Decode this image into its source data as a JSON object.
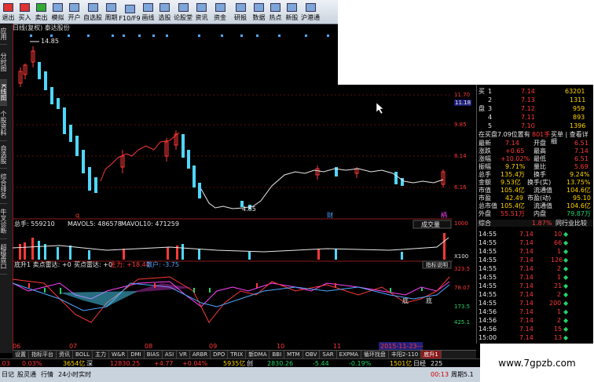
{
  "toolbar": {
    "items": [
      "退出",
      "买入",
      "卖出",
      "模拟",
      "开户",
      "自选股",
      "周期",
      "F10/F9",
      "画线",
      "选股",
      "论股堂",
      "资讯",
      "资金",
      "BBD",
      "研报",
      "预测",
      "数据",
      "热点",
      "新股",
      "沪港通"
    ]
  },
  "window": {
    "title": "日线(复权)  泰达股份"
  },
  "sidetabs": [
    "应用",
    "分时图",
    "K线图",
    "个股资料",
    "自选股",
    "综合排名",
    "牛叉诊断",
    "超级盘口"
  ],
  "price_axis": [
    "11.70",
    "11.18",
    "9.85",
    "8.14",
    "6.16"
  ],
  "price_axis_current": "11.18",
  "chart": {
    "high_label": "14.85",
    "low_label": "4.85",
    "markers": [
      "q",
      "财",
      "柄"
    ],
    "volume_header": "总手: 559210",
    "mavol5": "MAVOL5: 486578",
    "mavol10": "MAVOL10: 471259",
    "volume_dropdown": "成交量",
    "volume_axis": [
      "1000",
      "X100"
    ],
    "indicator_header": "底升1  卖点雷达: +0",
    "buy_radar": "买点雷达: +0",
    "main_force": "主力: +18.44",
    "retail": "散户: -3.75",
    "indicator_help": "指标说明",
    "indicator_axis": [
      "323.5",
      "78.07",
      "173.5",
      "425.1"
    ],
    "dates": [
      "06",
      "07",
      "08",
      "09",
      "10",
      "11"
    ],
    "date_highlight": "2015-11-23---",
    "tags": [
      "底",
      "底"
    ]
  },
  "bottom_tabs": [
    "设置",
    "指标平台",
    "资讯",
    "BOLL",
    "主力",
    "W&R",
    "DMI",
    "BIAS",
    "ASI",
    "VR",
    "ARBR",
    "DPO",
    "TRIX",
    "新DMA",
    "BBI",
    "MTM",
    "OBV",
    "SAR",
    "EXPMA",
    "循环找盘",
    "丰阳2-110",
    "底升1"
  ],
  "quote": {
    "sell_rows": [
      {
        "label": "1",
        "price": "7.14",
        "vol": "63201"
      },
      {
        "label": "2",
        "price": "7.13",
        "vol": "1311"
      },
      {
        "label": "3",
        "price": "7.12",
        "vol": "959"
      },
      {
        "label": "4",
        "price": "7.11",
        "vol": "893"
      },
      {
        "label": "5",
        "price": "7.10",
        "vol": "1396"
      }
    ],
    "side_label_buy": "买",
    "side_label_pan": "盘",
    "queue_line": "在买盘7.09位置有",
    "queue_count": "801手",
    "queue_link": "买单 | 查看详细",
    "stats": [
      {
        "k": "最新",
        "v": "7.14",
        "k2": "开盘",
        "v2": "6.51"
      },
      {
        "k": "涨跌",
        "v": "+0.65",
        "k2": "最高",
        "v2": "7.14"
      },
      {
        "k": "涨幅",
        "v": "+10.02%",
        "k2": "最低",
        "v2": "6.51"
      },
      {
        "k": "振幅",
        "v": "9.71%",
        "k2": "量比",
        "v2": "5.69"
      },
      {
        "k": "总手",
        "v": "135.4万",
        "k2": "换手",
        "v2": "9.24%"
      },
      {
        "k": "金额",
        "v": "9.53亿",
        "k2": "换手(实)",
        "v2": "13.75%"
      },
      {
        "k": "市值",
        "v": "105.4亿",
        "k2": "流通值",
        "v2": "104.6亿"
      },
      {
        "k": "市盈",
        "v": "42.49",
        "k2": "市盈(动)",
        "v2": "95.10"
      },
      {
        "k": "总市值",
        "v": "105.4亿",
        "k2": "流通值",
        "v2": "104.6亿"
      },
      {
        "k": "外盘",
        "v": "55.51万",
        "k2": "内盘",
        "v2": "79.87万"
      }
    ],
    "composite_label": "综合",
    "composite_value": "1.87%",
    "composite_link": "同行业比较",
    "trades": [
      {
        "t": "14:55",
        "p": "7.14",
        "v": "10"
      },
      {
        "t": "14:55",
        "p": "7.14",
        "v": "66"
      },
      {
        "t": "14:55",
        "p": "7.14",
        "v": "1"
      },
      {
        "t": "14:55",
        "p": "7.14",
        "v": "126"
      },
      {
        "t": "14:55",
        "p": "7.14",
        "v": "2"
      },
      {
        "t": "14:55",
        "p": "7.14",
        "v": "1"
      },
      {
        "t": "14:55",
        "p": "7.14",
        "v": "21"
      },
      {
        "t": "14:55",
        "p": "7.14",
        "v": "2"
      },
      {
        "t": "14:55",
        "p": "7.14",
        "v": "200"
      },
      {
        "t": "14:56",
        "p": "7.14",
        "v": "1"
      },
      {
        "t": "14:56",
        "p": "7.14",
        "v": "2"
      },
      {
        "t": "14:56",
        "p": "7.14",
        "v": "15"
      },
      {
        "t": "15:00",
        "p": "7.14",
        "v": "13"
      }
    ]
  },
  "ticker": {
    "a": ".03",
    "b": "0.03%",
    "c": "3654亿",
    "d": "深",
    "e": "12830.25",
    "f": "+4.77",
    "g": "+0.04%",
    "h": "5935亿",
    "i": "创",
    "j": "2830.26",
    "k": "-5.44",
    "l": "-0.19%",
    "m": "1501亿",
    "n": "日经",
    "o": "225"
  },
  "status": {
    "a": "日记",
    "b": "股灵通",
    "c": "行情",
    "d": "24小时实时",
    "e": "00:13",
    "f": "周期5.1"
  },
  "watermark": "www.7gpzb.com"
}
